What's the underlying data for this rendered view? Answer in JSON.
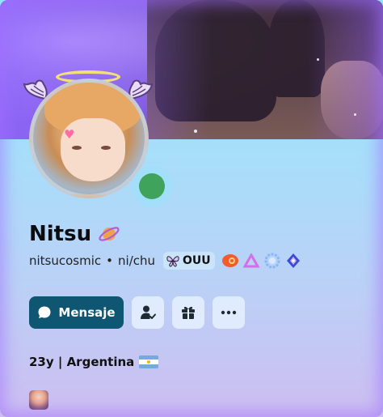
{
  "profile": {
    "display_name": "Nitsu",
    "username": "nitsucosmic",
    "pronouns": "ni/chu",
    "separator": "•",
    "guild_tag": "OUU",
    "status": "online",
    "bio_line": "23y | Argentina"
  },
  "actions": {
    "message_label": "Mensaje"
  },
  "icons": {
    "name_badge": "planet-icon",
    "tag_icon": "butterfly-icon",
    "badges": [
      "nitro-orbit-icon",
      "hypesquad-triangle-icon",
      "boost-ring-icon",
      "quest-badge-icon"
    ],
    "add_friend": "add-friend-icon",
    "gift": "gift-icon",
    "more": "more-icon"
  },
  "colors": {
    "primary_button": "#0f5673",
    "status_online": "#3fa35c",
    "halo": "#f3df7a"
  }
}
